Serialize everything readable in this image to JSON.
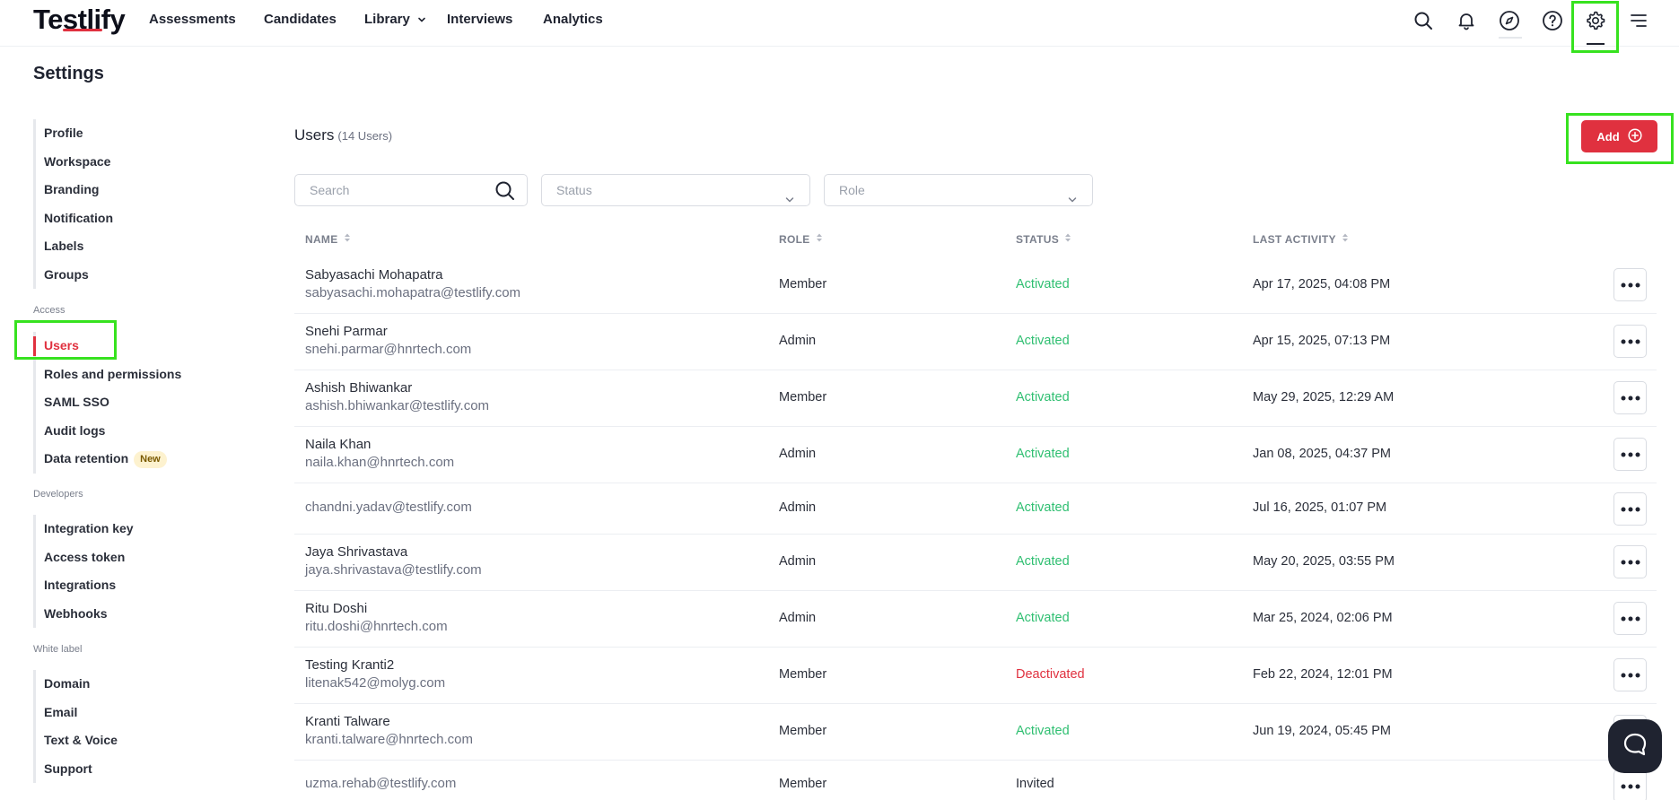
{
  "app": {
    "logo_text": "Testlify",
    "brand_color": "#e0313f",
    "highlight_color": "#37e21f"
  },
  "nav": {
    "items": [
      {
        "label": "Assessments"
      },
      {
        "label": "Candidates"
      },
      {
        "label": "Library"
      },
      {
        "label": "Interviews"
      },
      {
        "label": "Analytics"
      }
    ],
    "icons": [
      "search-icon",
      "bell-icon",
      "compass-icon",
      "help-icon",
      "gear-icon",
      "menu-icon"
    ]
  },
  "page": {
    "title": "Settings"
  },
  "sidebar": {
    "general": [
      "Profile",
      "Workspace",
      "Branding",
      "Notification",
      "Labels",
      "Groups"
    ],
    "access_title": "Access",
    "access": [
      "Users",
      "Roles and permissions",
      "SAML SSO",
      "Audit logs",
      "Data retention"
    ],
    "new_badge": "New",
    "developers_title": "Developers",
    "developers": [
      "Integration key",
      "Access token",
      "Integrations",
      "Webhooks"
    ],
    "whitelabel_title": "White label",
    "whitelabel": [
      "Domain",
      "Email",
      "Text & Voice",
      "Support"
    ],
    "active_item": "Users"
  },
  "users": {
    "title": "Users",
    "count": "(14 Users)",
    "add_label": "Add",
    "search_placeholder": "Search",
    "status_placeholder": "Status",
    "role_placeholder": "Role",
    "columns": [
      "NAME",
      "ROLE",
      "STATUS",
      "LAST ACTIVITY"
    ],
    "rows": [
      {
        "name": "Sabyasachi Mohapatra",
        "email": "sabyasachi.mohapatra@testlify.com",
        "role": "Member",
        "status": "Activated",
        "last_activity": "Apr 17, 2025, 04:08 PM"
      },
      {
        "name": "Snehi Parmar",
        "email": "snehi.parmar@hnrtech.com",
        "role": "Admin",
        "status": "Activated",
        "last_activity": "Apr 15, 2025, 07:13 PM"
      },
      {
        "name": "Ashish Bhiwankar",
        "email": "ashish.bhiwankar@testlify.com",
        "role": "Member",
        "status": "Activated",
        "last_activity": "May 29, 2025, 12:29 AM"
      },
      {
        "name": "Naila Khan",
        "email": "naila.khan@hnrtech.com",
        "role": "Admin",
        "status": "Activated",
        "last_activity": "Jan 08, 2025, 04:37 PM"
      },
      {
        "name": "",
        "email": "chandni.yadav@testlify.com",
        "role": "Admin",
        "status": "Activated",
        "last_activity": "Jul 16, 2025, 01:07 PM"
      },
      {
        "name": "Jaya Shrivastava",
        "email": "jaya.shrivastava@testlify.com",
        "role": "Admin",
        "status": "Activated",
        "last_activity": "May 20, 2025, 03:55 PM"
      },
      {
        "name": "Ritu Doshi",
        "email": "ritu.doshi@hnrtech.com",
        "role": "Admin",
        "status": "Activated",
        "last_activity": "Mar 25, 2024, 02:06 PM"
      },
      {
        "name": "Testing Kranti2",
        "email": "litenak542@molyg.com",
        "role": "Member",
        "status": "Deactivated",
        "last_activity": "Feb 22, 2024, 12:01 PM"
      },
      {
        "name": "Kranti Talware",
        "email": "kranti.talware@hnrtech.com",
        "role": "Member",
        "status": "Activated",
        "last_activity": "Jun 19, 2024, 05:45 PM"
      },
      {
        "name": "",
        "email": "uzma.rehab@testlify.com",
        "role": "Member",
        "status": "Invited",
        "last_activity": ""
      }
    ]
  }
}
